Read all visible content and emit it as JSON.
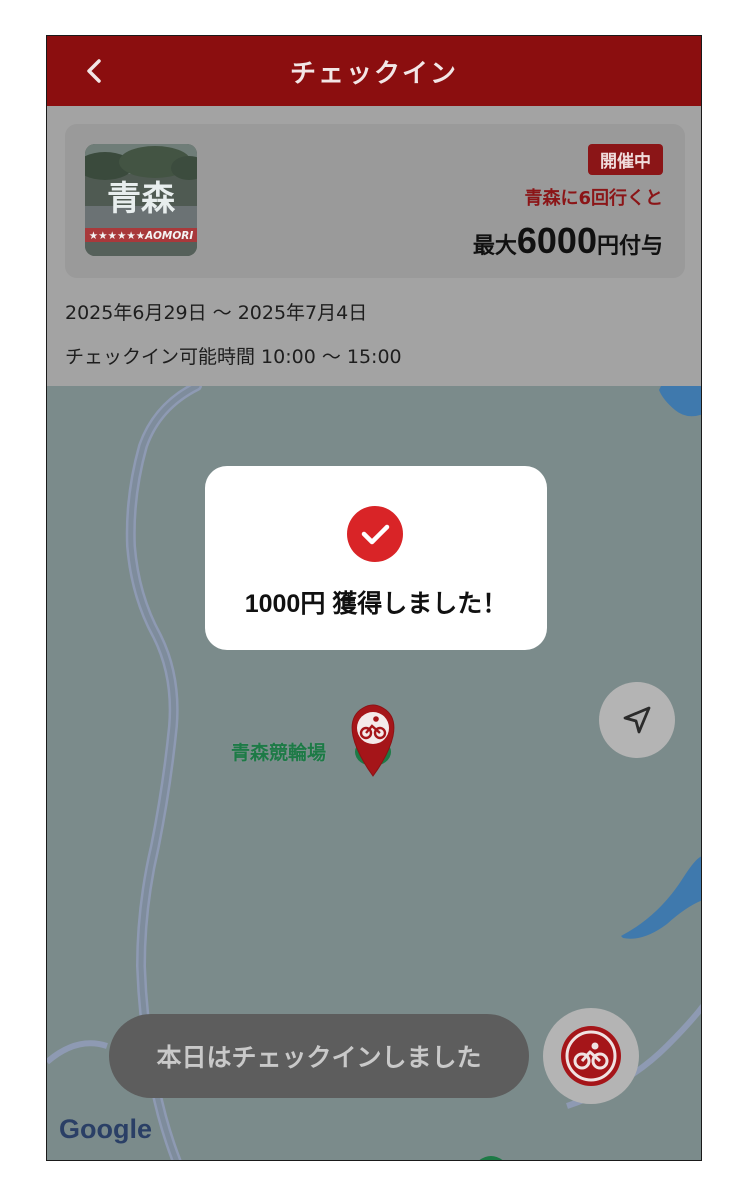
{
  "header": {
    "title": "チェックイン"
  },
  "event": {
    "thumb_text": "青森",
    "thumb_banner": "★★★★★★AOMORI",
    "status_badge": "開催中",
    "promo": "青森に6回行くと",
    "amount_prefix": "最大",
    "amount_value": "6000",
    "amount_suffix": "円付与",
    "dates": "2025年6月29日 ～ 2025年7月4日",
    "hours": "チェックイン可能時間 10:00 ～ 15:00"
  },
  "modal": {
    "message": "1000円 獲得しました！"
  },
  "map": {
    "venue_label": "青森競輪場",
    "attribution": "Google"
  },
  "bottom": {
    "status_text": "本日はチェックインしました"
  },
  "colors": {
    "header_bg": "#8b0e0f",
    "accent_red": "#d92427",
    "map_bg": "#7b8b8b",
    "venue_green": "#1d7a46"
  },
  "icons": {
    "back": "chevron-left-icon",
    "check": "check-circle-icon",
    "locate": "navigation-arrow-icon",
    "venue": "bicycle-pin-icon",
    "fab": "bicycle-icon"
  }
}
